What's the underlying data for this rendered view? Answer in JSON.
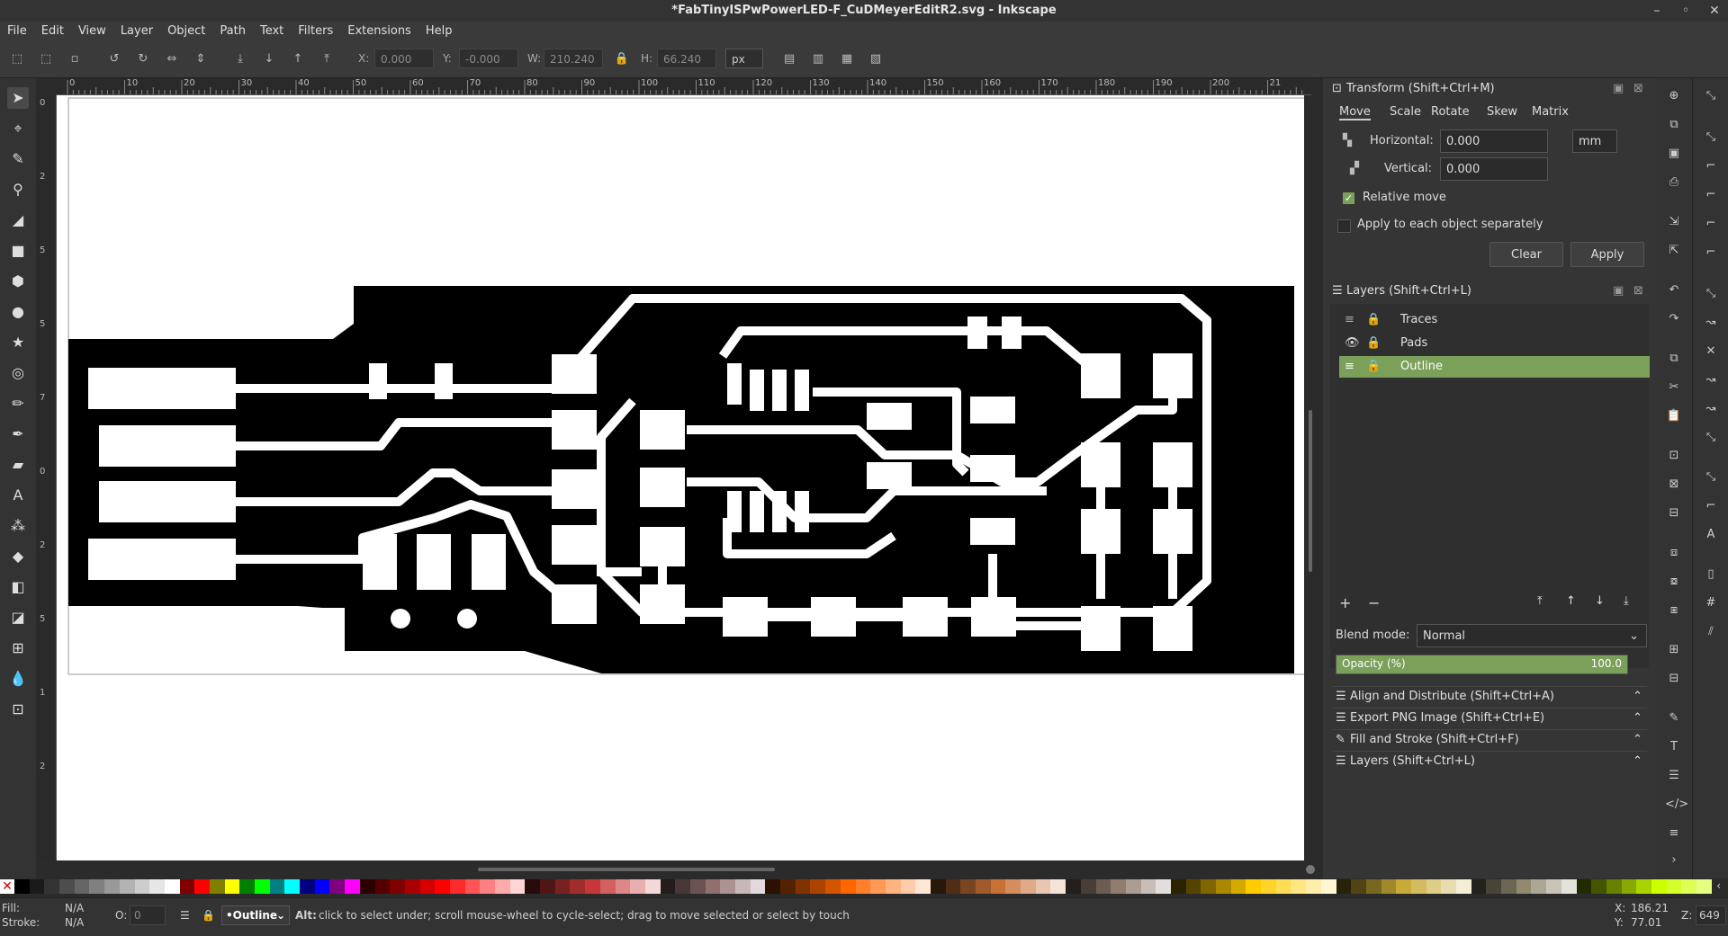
{
  "window": {
    "title": "*FabTinyISPwPowerLED-F_CuDMeyerEditR2.svg - Inkscape",
    "controls": [
      "–",
      "◦",
      "✕"
    ]
  },
  "menu": [
    "File",
    "Edit",
    "View",
    "Layer",
    "Object",
    "Path",
    "Text",
    "Filters",
    "Extensions",
    "Help"
  ],
  "toolctrl": {
    "x_label": "X:",
    "x_value": "0.000",
    "y_label": "Y:",
    "y_value": "-0.000",
    "w_label": "W:",
    "w_value": "210.240",
    "h_label": "H:",
    "h_value": "66.240",
    "unit": "px"
  },
  "ruler": {
    "h_ticks": [
      "0",
      "10",
      "20",
      "30",
      "40",
      "50",
      "60",
      "70",
      "80",
      "90",
      "100",
      "110",
      "120",
      "130",
      "140",
      "150",
      "160",
      "170",
      "180",
      "190",
      "200",
      "21"
    ],
    "v_ticks": [
      "0",
      "2",
      "5",
      "5",
      "7",
      "0",
      "2",
      "5",
      "1",
      "2"
    ]
  },
  "transform": {
    "title": "Transform (Shift+Ctrl+M)",
    "tabs": [
      "Move",
      "Scale",
      "Rotate",
      "Skew",
      "Matrix"
    ],
    "horizontal_label": "Horizontal:",
    "horizontal_value": "0.000",
    "vertical_label": "Vertical:",
    "vertical_value": "0.000",
    "unit": "mm",
    "relative_move": "Relative move",
    "apply_each": "Apply to each object separately",
    "clear": "Clear",
    "apply": "Apply"
  },
  "layers": {
    "title": "Layers (Shift+Ctrl+L)",
    "items": [
      {
        "name": "Traces",
        "visible": false,
        "selected": false
      },
      {
        "name": "Pads",
        "visible": true,
        "selected": false
      },
      {
        "name": "Outline",
        "visible": false,
        "selected": true
      }
    ],
    "add": "+",
    "remove": "−",
    "blend_label": "Blend mode:",
    "blend_value": "Normal",
    "opacity_label": "Opacity (%)",
    "opacity_value": "100.0",
    "opacity_fraction": 1.0
  },
  "collapsed_panels": [
    "Align and Distribute (Shift+Ctrl+A)",
    "Export PNG Image (Shift+Ctrl+E)",
    "Fill and Stroke (Shift+Ctrl+F)",
    "Layers (Shift+Ctrl+L)"
  ],
  "status": {
    "fill_label": "Fill:",
    "fill_value": "N/A",
    "stroke_label": "Stroke:",
    "stroke_value": "N/A",
    "o_label": "O:",
    "o_value": "0",
    "layer_value": "•Outline",
    "alt": "Alt:",
    "message": "click to select under; scroll mouse-wheel to cycle-select; drag to move selected or select by touch",
    "x_label": "X:",
    "x_value": "186.21",
    "y_label": "Y:",
    "y_value": "77.01",
    "z_label": "Z:",
    "z_value": "649"
  },
  "palette": [
    "#000000",
    "#1a1a1a",
    "#333333",
    "#4d4d4d",
    "#666666",
    "#808080",
    "#999999",
    "#b3b3b3",
    "#cccccc",
    "#e6e6e6",
    "#ffffff",
    "#800000",
    "#ff0000",
    "#808000",
    "#ffff00",
    "#008000",
    "#00ff00",
    "#008080",
    "#00ffff",
    "#000080",
    "#0000ff",
    "#800080",
    "#ff00ff",
    "#2b0000",
    "#550000",
    "#800000",
    "#aa0000",
    "#d40000",
    "#ff0000",
    "#ff2a2a",
    "#ff5555",
    "#ff8080",
    "#ffaaaa",
    "#ffd5d5",
    "#280b0b",
    "#501616",
    "#782121",
    "#a02c2c",
    "#c83737",
    "#d35f5f",
    "#de8787",
    "#e9afaf",
    "#f4d7d7",
    "#241c1c",
    "#483737",
    "#6c5353",
    "#916f6f",
    "#ac9393",
    "#c8b7b7",
    "#e3dbdb",
    "#2b1100",
    "#552200",
    "#803300",
    "#aa4400",
    "#d45500",
    "#ff6600",
    "#ff7f2a",
    "#ff9955",
    "#ffb380",
    "#ffccaa",
    "#ffe6d5",
    "#28170b",
    "#502d16",
    "#784421",
    "#a05a2c",
    "#c87137",
    "#d38d5f",
    "#deaa87",
    "#e9c6af",
    "#f4e3d7",
    "#241f1c",
    "#483e37",
    "#6c5d53",
    "#917c6f",
    "#ac9d93",
    "#c8beb7",
    "#e3dedb",
    "#2b2200",
    "#554400",
    "#806600",
    "#aa8800",
    "#d4aa00",
    "#ffcc00",
    "#ffd42a",
    "#ffdd55",
    "#ffe680",
    "#ffeeaa",
    "#fff6d5",
    "#28220b",
    "#504416",
    "#786721",
    "#a0892c",
    "#c8ab37",
    "#d3bc5f",
    "#decd87",
    "#e9ddaf",
    "#f4eed7",
    "#24221c",
    "#484537",
    "#6c6753",
    "#918a6f",
    "#aca793",
    "#c8c4b7",
    "#e3e2db",
    "#222b00",
    "#445500",
    "#668000",
    "#88aa00",
    "#aad400",
    "#ccff00",
    "#d4ff2a",
    "#ddff55",
    "#e5ff80"
  ]
}
